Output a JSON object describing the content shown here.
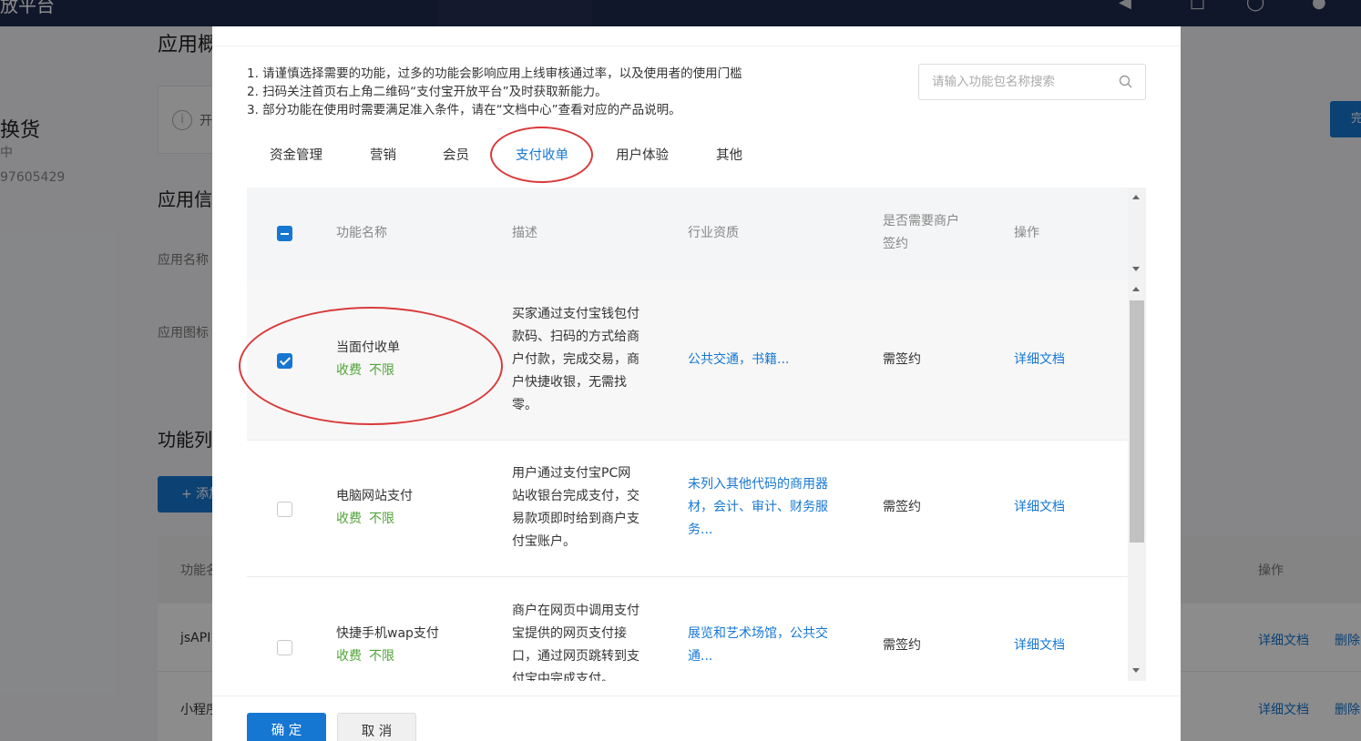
{
  "background": {
    "brand_partial": "放平台",
    "overview_title": "应用概",
    "app_name_partial": "换货",
    "app_status_partial": "中",
    "app_id_partial": "97605429",
    "notice_text": "开",
    "create_button_partial": "完",
    "info_title": "应用信",
    "label_app_name": "应用名称",
    "label_app_icon": "应用图标",
    "func_list_title": "功能列",
    "add_button": "+ 添加",
    "table_headers": [
      "功能名",
      "操作"
    ],
    "rows": [
      {
        "name": "jsAPI",
        "doc": "详细文档",
        "delete": "删除"
      },
      {
        "name": "小程序",
        "doc": "详细文档",
        "delete": "删除"
      }
    ]
  },
  "modal": {
    "notes": [
      "1. 请谨慎选择需要的功能，过多的功能会影响应用上线审核通过率，以及使用者的使用门槛",
      "2. 扫码关注首页右上角二维码“支付宝开放平台”及时获取新能力。",
      "3. 部分功能在使用时需要满足准入条件，请在“文档中心”查看对应的产品说明。"
    ],
    "search_placeholder": "请输入功能包名称搜索",
    "tabs": [
      "资金管理",
      "营销",
      "会员",
      "支付收单",
      "用户体验",
      "其他"
    ],
    "active_tab": "支付收单",
    "table": {
      "headers": {
        "name": "功能名称",
        "desc": "描述",
        "qualification": "行业资质",
        "sign_line1": "是否需要商户",
        "sign_line2": "签约",
        "action": "操作"
      },
      "rows": [
        {
          "checked": true,
          "name": "当面付收单",
          "tags": [
            "收费",
            "不限"
          ],
          "desc": [
            "买家通过支付宝钱包付",
            "款码、扫码的方式给商",
            "户付款，完成交易，商",
            "户快捷收银，无需找",
            "零。"
          ],
          "qualification": [
            "公共交通，书籍..."
          ],
          "sign": "需签约",
          "action": "详细文档"
        },
        {
          "checked": false,
          "name": "电脑网站支付",
          "tags": [
            "收费",
            "不限"
          ],
          "desc": [
            "用户通过支付宝PC网",
            "站收银台完成支付，交",
            "易款项即时给到商户支",
            "付宝账户。"
          ],
          "qualification": [
            "未列入其他代码的商用器",
            "材，会计、审计、财务服",
            "务..."
          ],
          "sign": "需签约",
          "action": "详细文档"
        },
        {
          "checked": false,
          "name": "快捷手机wap支付",
          "tags": [
            "收费",
            "不限"
          ],
          "desc": [
            "商户在网页中调用支付",
            "宝提供的网页支付接",
            "口，通过网页跳转到支",
            "付宝中完成支付。"
          ],
          "qualification": [
            "展览和艺术场馆，公共交",
            "通..."
          ],
          "sign": "需签约",
          "action": "详细文档"
        }
      ]
    },
    "ok_button": "确 定",
    "cancel_button": "取 消"
  },
  "colors": {
    "accent": "#1677d2",
    "tag_green": "#52a33a",
    "annotation_red": "#d93a3a",
    "overlay": "rgba(0,0,0,0.45)"
  }
}
